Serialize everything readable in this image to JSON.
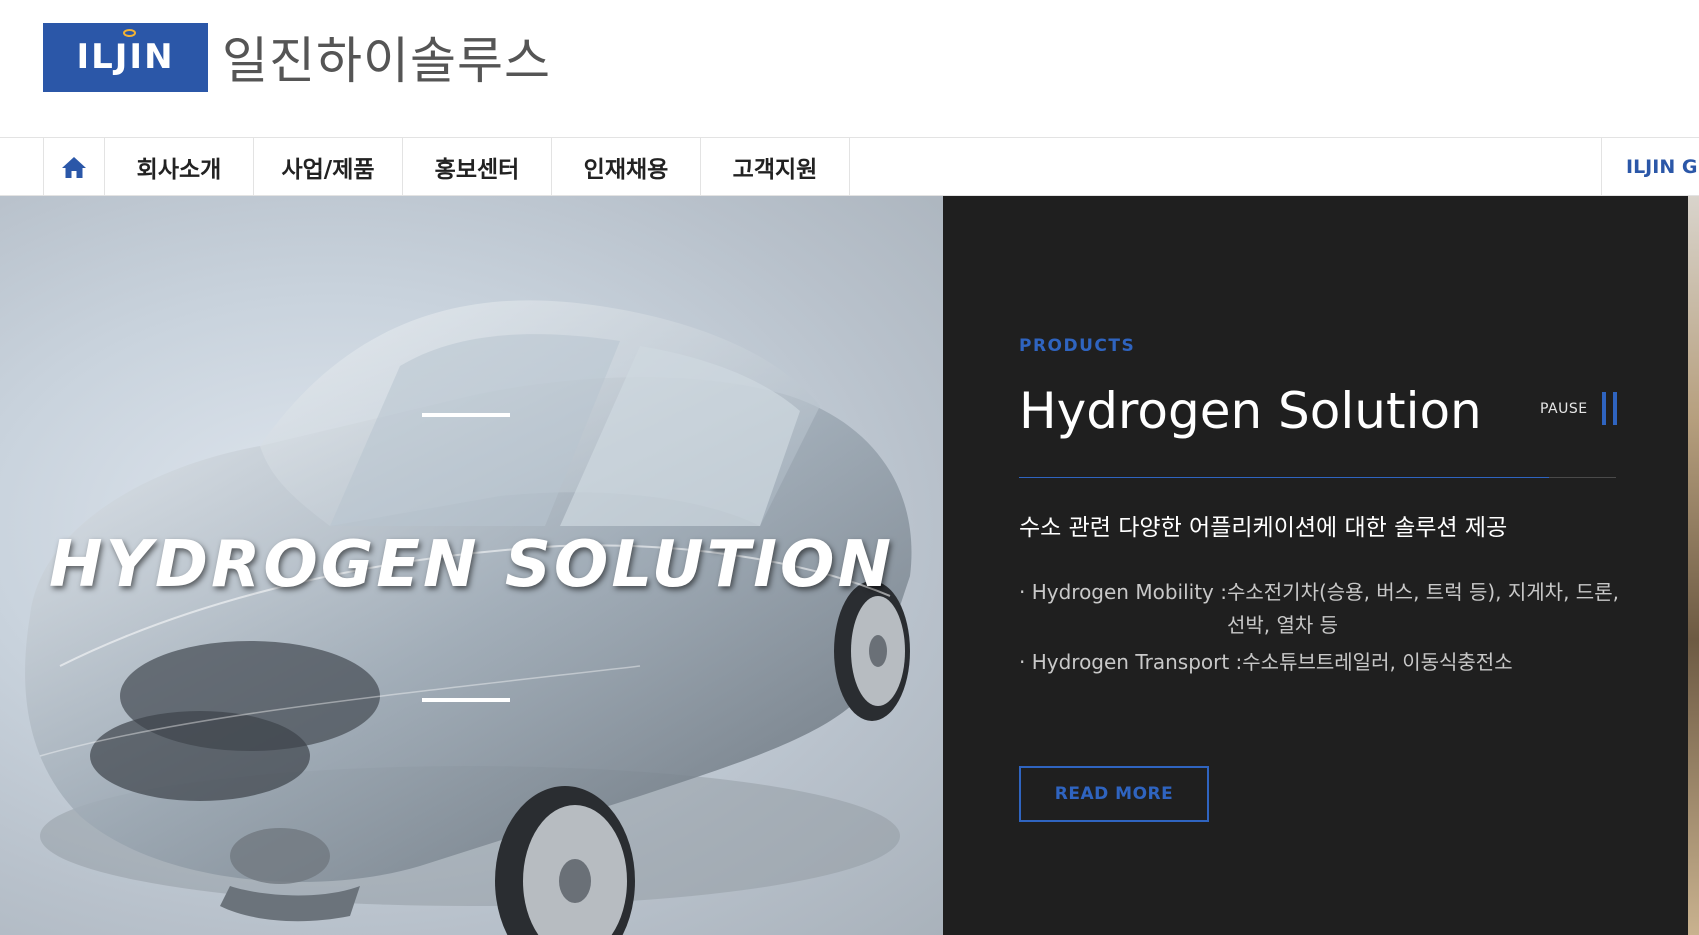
{
  "header": {
    "logo_text": "ILJIN",
    "company_name": "일진하이솔루스"
  },
  "nav": {
    "home_icon": "home-icon",
    "items": [
      {
        "label": "회사소개"
      },
      {
        "label": "사업/제품"
      },
      {
        "label": "홍보센터"
      },
      {
        "label": "인재채용"
      },
      {
        "label": "고객지원"
      }
    ],
    "group_link": "ILJIN GR"
  },
  "hero": {
    "image_title": "HYDROGEN SOLUTION",
    "category": "PRODUCTS",
    "title": "Hydrogen Solution",
    "pause_label": "PAUSE",
    "subtitle": "수소 관련 다양한 어플리케이션에 대한 솔루션 제공",
    "items": [
      {
        "label": "· Hydrogen Mobility : ",
        "value": "수소전기차(승용, 버스, 트럭 등), 지게차, 드론, 선박, 열차 등"
      },
      {
        "label": "· Hydrogen Transport : ",
        "value": "수소튜브트레일러, 이동식충전소"
      }
    ],
    "button_label": "READ MORE"
  },
  "colors": {
    "brand_blue": "#2b57a8",
    "accent_blue": "#2f64c0",
    "panel_bg": "#1f1f1f"
  }
}
